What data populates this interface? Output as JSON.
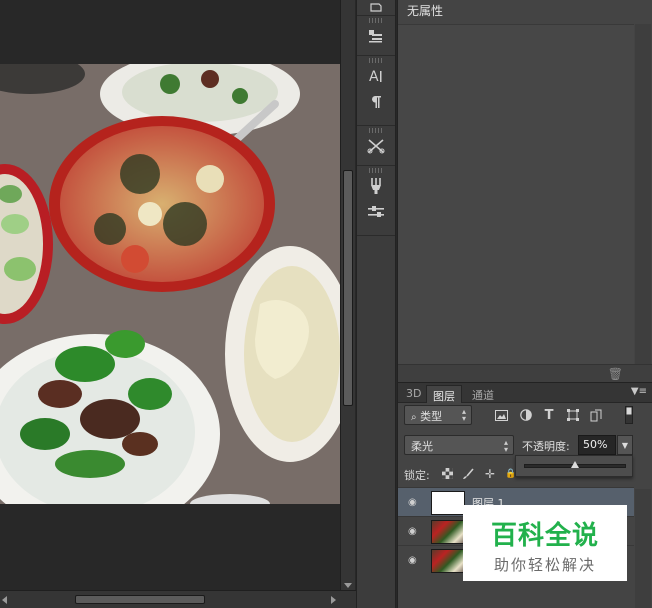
{
  "properties_panel": {
    "title": "无属性"
  },
  "layers_panel": {
    "tabs": [
      {
        "label": "3D"
      },
      {
        "label": "图层"
      },
      {
        "label": "通道"
      }
    ],
    "filter_kind": "类型",
    "blend_mode": "柔光",
    "opacity_label": "不透明度:",
    "opacity_value": "50%",
    "opacity_fraction": 0.5,
    "lock_label": "锁定:",
    "layers": [
      {
        "name": "图层 1",
        "selected": true,
        "thumbnail": "white"
      },
      {
        "name": "",
        "selected": false,
        "thumbnail": "photo"
      },
      {
        "name": "",
        "selected": false,
        "thumbnail": "photo"
      }
    ]
  },
  "watermark": {
    "line1": "百科全说",
    "line2": "助你轻松解决"
  },
  "colors": {
    "panel": "#444444",
    "selected_layer": "#56606c",
    "watermark_green": "#22b14c"
  }
}
